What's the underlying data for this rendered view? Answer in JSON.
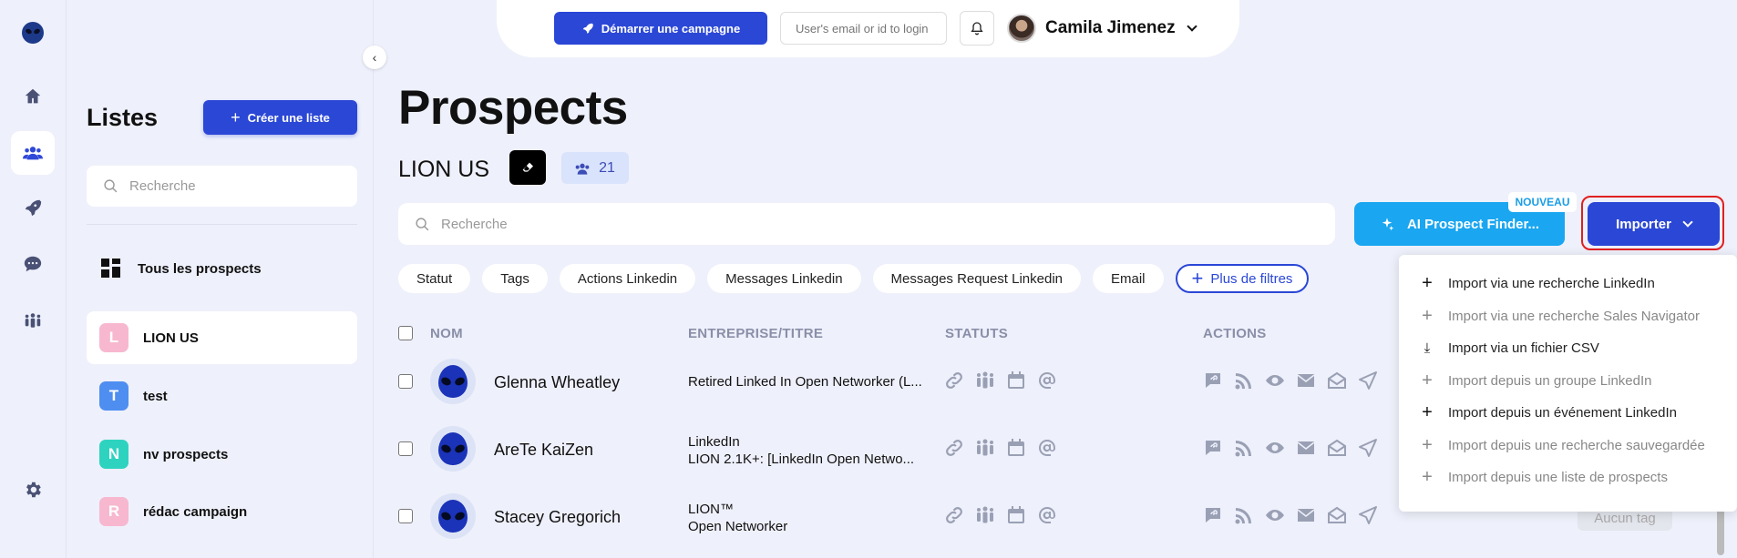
{
  "topbar": {
    "campaign_label": "Démarrer une campagne",
    "login_placeholder": "User's email or id to login",
    "user_name": "Camila Jimenez"
  },
  "lists": {
    "title": "Listes",
    "create_label": "Créer une liste",
    "search_placeholder": "Recherche",
    "all_prospects_label": "Tous les prospects",
    "items": [
      {
        "letter": "L",
        "label": "LION US",
        "color": "#f7b8cf"
      },
      {
        "letter": "T",
        "label": "test",
        "color": "#4e8ef0"
      },
      {
        "letter": "N",
        "label": "nv prospects",
        "color": "#2ed3c0"
      },
      {
        "letter": "R",
        "label": "rédac campaign",
        "color": "#f7b8cf"
      }
    ]
  },
  "main": {
    "title": "Prospects",
    "list_name": "LION US",
    "count": "21",
    "search_placeholder": "Recherche",
    "ai_label": "AI Prospect Finder...",
    "nouveau": "NOUVEAU",
    "import_label": "Importer",
    "filters": [
      "Statut",
      "Tags",
      "Actions Linkedin",
      "Messages Linkedin",
      "Messages Request Linkedin",
      "Email"
    ],
    "more_filters": "Plus de filtres",
    "columns": {
      "name": "NOM",
      "company": "ENTREPRISE/TITRE",
      "status": "STATUTS",
      "actions": "ACTIONS"
    },
    "rows": [
      {
        "name": "Glenna Wheatley",
        "line1": "Retired Linked In Open Networker (L...",
        "line2": ""
      },
      {
        "name": "AreTe KaiZen",
        "line1": "LinkedIn",
        "line2": "LION 2.1K+: [LinkedIn Open Netwo..."
      },
      {
        "name": "Stacey Gregorich",
        "line1": "LION™",
        "line2": "Open Networker"
      }
    ],
    "no_tag": "Aucun tag"
  },
  "dropdown": {
    "items": [
      {
        "label": "Import via une recherche LinkedIn",
        "muted": false
      },
      {
        "label": "Import via une recherche Sales Navigator",
        "muted": true
      },
      {
        "label": "Import via un fichier CSV",
        "muted": false
      },
      {
        "label": "Import depuis un groupe LinkedIn",
        "muted": true
      },
      {
        "label": "Import depuis un événement LinkedIn",
        "muted": false
      },
      {
        "label": "Import depuis une recherche sauvegardée",
        "muted": true
      },
      {
        "label": "Import depuis une liste de prospects",
        "muted": true
      }
    ]
  },
  "colors": {
    "accent": "#2b47d6",
    "ai": "#1aa6f0",
    "highlight": "#e02020"
  }
}
